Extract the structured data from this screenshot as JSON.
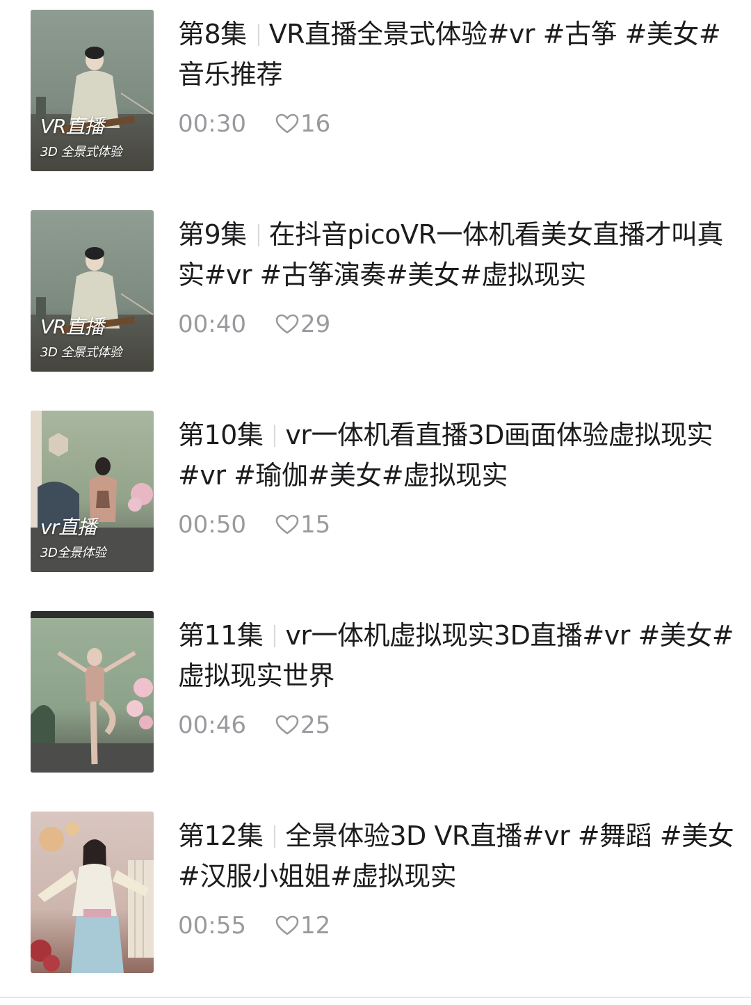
{
  "videos": [
    {
      "episode": "第8集",
      "title": "VR直播全景式体验#vr #古筝 #美女#音乐推荐",
      "duration": "00:30",
      "likes": "16",
      "overlay_line1": "VR直播",
      "overlay_line2": "3D 全景式体验"
    },
    {
      "episode": "第9集",
      "title": "在抖音picoVR一体机看美女直播才叫真实#vr #古筝演奏#美女#虚拟现实",
      "duration": "00:40",
      "likes": "29",
      "overlay_line1": "VR直播",
      "overlay_line2": "3D 全景式体验"
    },
    {
      "episode": "第10集",
      "title": "vr一体机看直播3D画面体验虚拟现实#vr #瑜伽#美女#虚拟现实",
      "duration": "00:50",
      "likes": "15",
      "overlay_line1": "vr直播",
      "overlay_line2": "3D全景体验"
    },
    {
      "episode": "第11集",
      "title": "vr一体机虚拟现实3D直播#vr #美女#虚拟现实世界",
      "duration": "00:46",
      "likes": "25",
      "overlay_line1": "",
      "overlay_line2": ""
    },
    {
      "episode": "第12集",
      "title": "全景体验3D VR直播#vr #舞蹈 #美女#汉服小姐姐#虚拟现实",
      "duration": "00:55",
      "likes": "12",
      "overlay_line1": "",
      "overlay_line2": ""
    }
  ],
  "icons": {
    "like": "heart-outline-icon"
  },
  "colors": {
    "title_text": "#1c1c1e",
    "meta_text": "#9a9a9e",
    "separator": "#d8d8d8"
  }
}
